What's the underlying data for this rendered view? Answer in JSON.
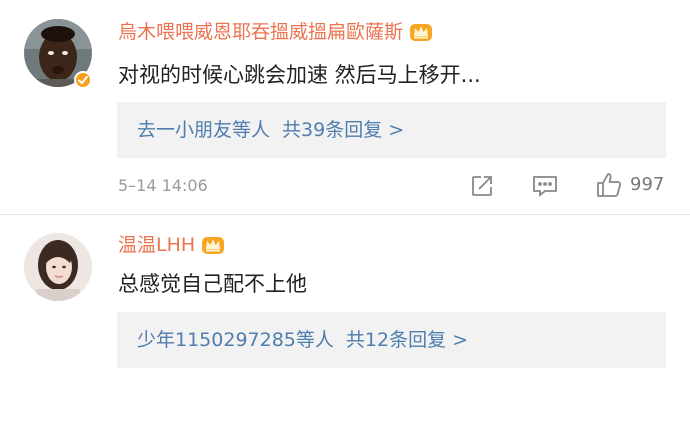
{
  "comments": [
    {
      "username": "烏木喂喂威恩耶吞搵威搵扁歐薩斯",
      "text": "对视的时候心跳会加速  然后马上移开...",
      "replies": {
        "users": "去一小朋友等人",
        "total": "共39条回复 >"
      },
      "time": "5–14 14:06",
      "likes": "997",
      "verified": true,
      "avatar_icon": "avatar-man-photo"
    },
    {
      "username": "温温LHH",
      "text": "总感觉自己配不上他",
      "replies": {
        "users": "少年1150297285等人",
        "total": "共12条回复 >"
      },
      "avatar_icon": "avatar-woman-photo"
    }
  ],
  "colors": {
    "username": "#eb7350",
    "link": "#507daf",
    "meta": "#9a9a9a",
    "reply_bg": "#f2f2f2",
    "verified_badge": "#f7a01a"
  },
  "icons": {
    "crown": "crown-icon",
    "share": "share-icon",
    "comment": "comment-icon",
    "like": "thumbs-up-icon"
  }
}
